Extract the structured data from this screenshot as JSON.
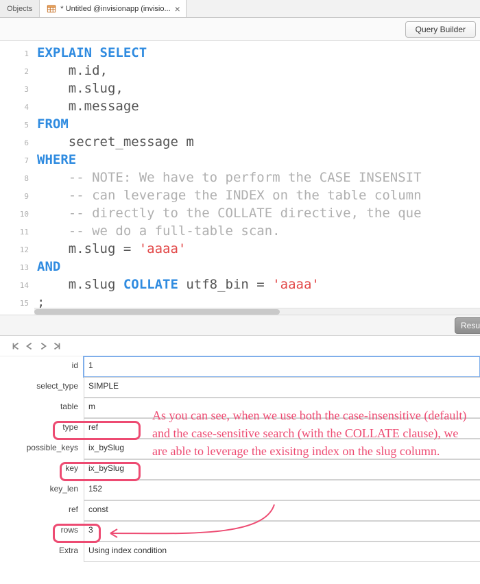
{
  "tabs": {
    "small": "Objects",
    "big_title": "* Untitled @invisionapp (invisio..."
  },
  "toolbar": {
    "query_builder": "Query Builder"
  },
  "code": {
    "lines": [
      "1",
      "2",
      "3",
      "4",
      "5",
      "6",
      "7",
      "8",
      "9",
      "10",
      "11",
      "12",
      "13",
      "14",
      "15"
    ],
    "t": {
      "explain": "EXPLAIN",
      "select": "SELECT",
      "from": "FROM",
      "where": "WHERE",
      "and": "AND",
      "collate": "COLLATE",
      "m_id": "    m.id,",
      "m_slug": "    m.slug,",
      "m_message": "    m.message",
      "table": "    secret_message m",
      "c1": "    -- NOTE: We have to perform the CASE INSENSIT",
      "c2": "    -- can leverage the INDEX on the table column",
      "c3": "    -- directly to the COLLATE directive, the que",
      "c4": "    -- we do a full-table scan.",
      "eq1a": "    m.slug = ",
      "eq2a": "    m.slug ",
      "eq2b": " utf8_bin = ",
      "str": "'aaaa'",
      "semi": ";"
    }
  },
  "results_button": "Resu",
  "explain": {
    "labels": {
      "id": "id",
      "select_type": "select_type",
      "table": "table",
      "type": "type",
      "possible_keys": "possible_keys",
      "key": "key",
      "key_len": "key_len",
      "ref": "ref",
      "rows": "rows",
      "extra": "Extra"
    },
    "values": {
      "id": "1",
      "select_type": "SIMPLE",
      "table": "m",
      "type": "ref",
      "possible_keys": "ix_bySlug",
      "key": "ix_bySlug",
      "key_len": "152",
      "ref": "const",
      "rows": "3",
      "extra": "Using index condition"
    }
  },
  "annotation": "As you can see, when we use both the case-insensitive (default) and the case-sensitive search (with the COLLATE clause), we are able to leverage the exisitng index on the slug column."
}
